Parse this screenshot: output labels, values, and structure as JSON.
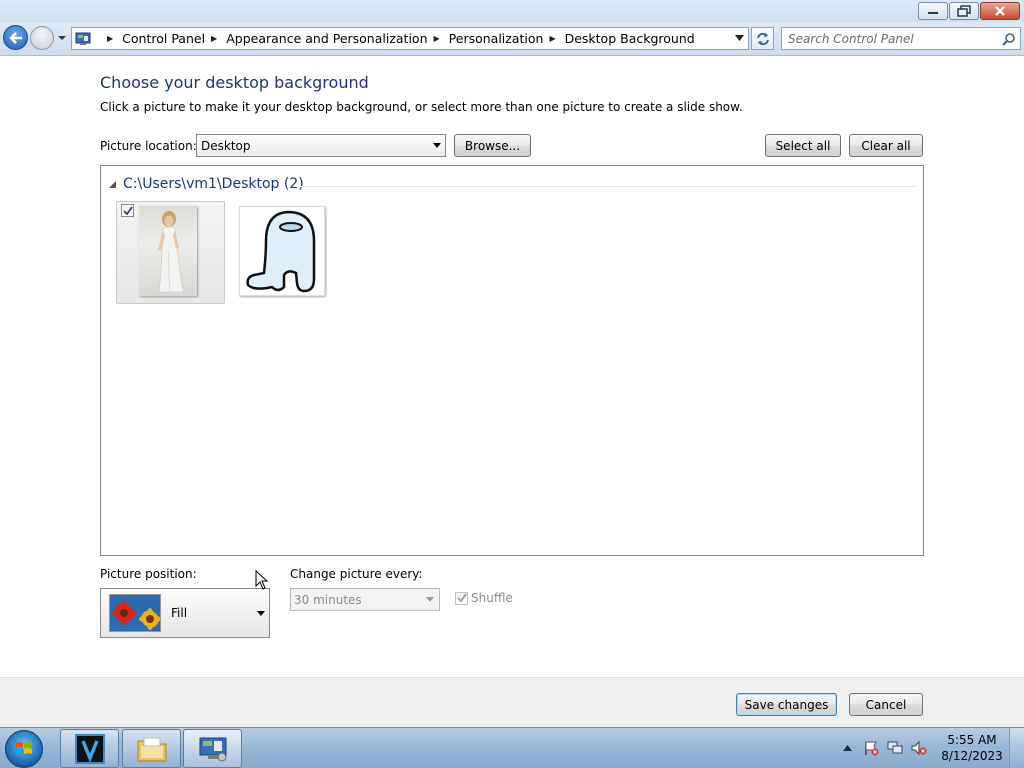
{
  "window": {
    "minimize_icon": "minimize-icon",
    "maximize_icon": "restore-icon",
    "close_icon": "close-icon"
  },
  "address_bar": {
    "breadcrumbs": [
      "Control Panel",
      "Appearance and Personalization",
      "Personalization",
      "Desktop Background"
    ],
    "search_placeholder": "Search Control Panel"
  },
  "main": {
    "title": "Choose your desktop background",
    "subtitle": "Click a picture to make it your desktop background, or select more than one picture to create a slide show.",
    "picture_location_label": "Picture location:",
    "picture_location_value": "Desktop",
    "browse_label": "Browse...",
    "select_all_label": "Select all",
    "clear_all_label": "Clear all",
    "group_title": "C:\\Users\\vm1\\Desktop (2)",
    "pictures": [
      {
        "name": "woman-in-white-dress-photo",
        "selected": true
      },
      {
        "name": "among-us-crewmate-drawing",
        "selected": false
      }
    ],
    "picture_position_label": "Picture position:",
    "picture_position_value": "Fill",
    "change_picture_label": "Change picture every:",
    "change_picture_value": "30 minutes",
    "shuffle_label": "Shuffle",
    "shuffle_checked": true
  },
  "footer": {
    "save_label": "Save changes",
    "cancel_label": "Cancel"
  },
  "taskbar": {
    "apps": [
      "V-app",
      "windows-explorer",
      "control-panel"
    ],
    "time": "5:55 AM",
    "date": "8/12/2023"
  }
}
